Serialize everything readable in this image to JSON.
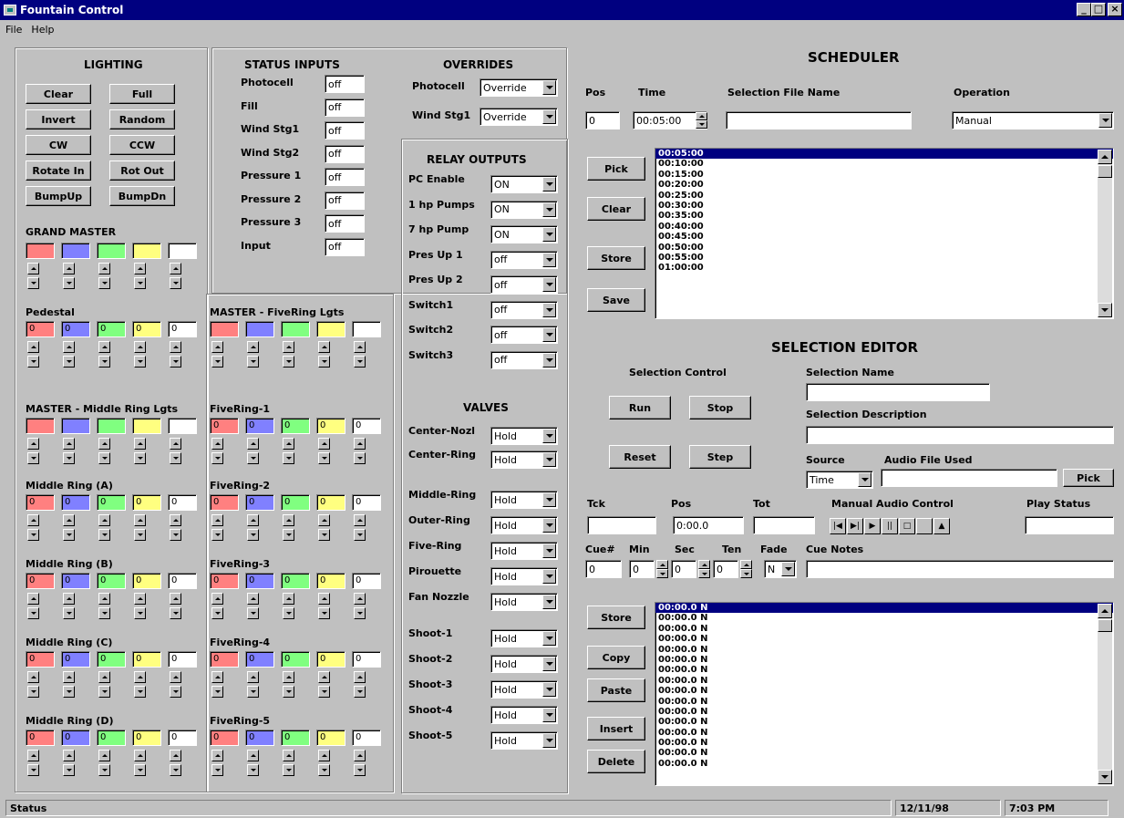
{
  "window": {
    "title": "Fountain Control"
  },
  "menu": [
    "File",
    "Help"
  ],
  "lighting": {
    "title": "LIGHTING",
    "buttons": [
      "Clear",
      "Full",
      "Invert",
      "Random",
      "CW",
      "CCW",
      "Rotate In",
      "Rot Out",
      "BumpUp",
      "BumpDn"
    ]
  },
  "grand_master": {
    "title": "GRAND MASTER"
  },
  "pedestal": {
    "title": "Pedestal",
    "values": [
      "0",
      "0",
      "0",
      "0",
      "0"
    ]
  },
  "master_middle": {
    "title": "MASTER - Middle Ring Lgts"
  },
  "master_five": {
    "title": "MASTER - FiveRing Lgts"
  },
  "light_groups_left": [
    {
      "title": "Middle Ring (A)",
      "values": [
        "0",
        "0",
        "0",
        "0",
        "0"
      ]
    },
    {
      "title": "Middle Ring (B)",
      "values": [
        "0",
        "0",
        "0",
        "0",
        "0"
      ]
    },
    {
      "title": "Middle Ring (C)",
      "values": [
        "0",
        "0",
        "0",
        "0",
        "0"
      ]
    },
    {
      "title": "Middle Ring (D)",
      "values": [
        "0",
        "0",
        "0",
        "0",
        "0"
      ]
    }
  ],
  "light_groups_right": [
    {
      "title": "FiveRing-1",
      "values": [
        "0",
        "0",
        "0",
        "0",
        "0"
      ]
    },
    {
      "title": "FiveRing-2",
      "values": [
        "0",
        "0",
        "0",
        "0",
        "0"
      ]
    },
    {
      "title": "FiveRing-3",
      "values": [
        "0",
        "0",
        "0",
        "0",
        "0"
      ]
    },
    {
      "title": "FiveRing-4",
      "values": [
        "0",
        "0",
        "0",
        "0",
        "0"
      ]
    },
    {
      "title": "FiveRing-5",
      "values": [
        "0",
        "0",
        "0",
        "0",
        "0"
      ]
    }
  ],
  "swatch_colors": [
    "#ff8080",
    "#8080ff",
    "#80ff80",
    "#ffff80",
    "#ffffff"
  ],
  "status_inputs": {
    "title": "STATUS INPUTS",
    "items": [
      {
        "label": "Photocell",
        "value": "off"
      },
      {
        "label": "Fill",
        "value": "off"
      },
      {
        "label": "Wind Stg1",
        "value": "off"
      },
      {
        "label": "Wind Stg2",
        "value": "off"
      },
      {
        "label": "Pressure 1",
        "value": "off"
      },
      {
        "label": "Pressure 2",
        "value": "off"
      },
      {
        "label": "Pressure 3",
        "value": "off"
      },
      {
        "label": "Input",
        "value": "off"
      }
    ]
  },
  "overrides": {
    "title": "OVERRIDES",
    "items": [
      {
        "label": "Photocell",
        "value": "Override"
      },
      {
        "label": "Wind Stg1",
        "value": "Override"
      }
    ]
  },
  "relay_outputs": {
    "title": "RELAY OUTPUTS",
    "items": [
      {
        "label": "PC Enable",
        "value": "ON"
      },
      {
        "label": "1 hp Pumps",
        "value": "ON"
      },
      {
        "label": "7 hp Pump",
        "value": "ON"
      },
      {
        "label": "Pres Up 1",
        "value": "off"
      },
      {
        "label": "Pres Up 2",
        "value": "off"
      },
      {
        "label": "Switch1",
        "value": "off"
      },
      {
        "label": "Switch2",
        "value": "off"
      },
      {
        "label": "Switch3",
        "value": "off"
      }
    ]
  },
  "valves": {
    "title": "VALVES",
    "items": [
      {
        "label": "Center-Nozl",
        "value": "Hold"
      },
      {
        "label": "Center-Ring",
        "value": "Hold"
      },
      {
        "label": "Middle-Ring",
        "value": "Hold"
      },
      {
        "label": "Outer-Ring",
        "value": "Hold"
      },
      {
        "label": "Five-Ring",
        "value": "Hold"
      },
      {
        "label": "Pirouette",
        "value": "Hold"
      },
      {
        "label": "Fan Nozzle",
        "value": "Hold"
      },
      {
        "label": "Shoot-1",
        "value": "Hold"
      },
      {
        "label": "Shoot-2",
        "value": "Hold"
      },
      {
        "label": "Shoot-3",
        "value": "Hold"
      },
      {
        "label": "Shoot-4",
        "value": "Hold"
      },
      {
        "label": "Shoot-5",
        "value": "Hold"
      }
    ]
  },
  "scheduler": {
    "title": "SCHEDULER",
    "pos_label": "Pos",
    "time_label": "Time",
    "file_label": "Selection File Name",
    "op_label": "Operation",
    "pos": "0",
    "time": "00:05:00",
    "file": "",
    "operation": "Manual",
    "buttons": [
      "Pick",
      "Clear",
      "Store",
      "Save"
    ],
    "times": [
      "00:05:00",
      "00:10:00",
      "00:15:00",
      "00:20:00",
      "00:25:00",
      "00:30:00",
      "00:35:00",
      "00:40:00",
      "00:45:00",
      "00:50:00",
      "00:55:00",
      "01:00:00"
    ]
  },
  "editor": {
    "title": "SELECTION EDITOR",
    "control_label": "Selection Control",
    "buttons": [
      "Run",
      "Stop",
      "Reset",
      "Step"
    ],
    "name_label": "Selection Name",
    "desc_label": "Selection Description",
    "source_label": "Source",
    "audio_label": "Audio File Used",
    "source": "Time",
    "pick": "Pick",
    "tck_label": "Tck",
    "pos_label": "Pos",
    "tot_label": "Tot",
    "manual_audio_label": "Manual Audio Control",
    "play_status_label": "Play Status",
    "pos_value": "0:00.0",
    "cue_labels": [
      "Cue#",
      "Min",
      "Sec",
      "Ten",
      "Fade",
      "Cue Notes"
    ],
    "cue_values": [
      "0",
      "0",
      "0",
      "0",
      "N"
    ],
    "cue_buttons": [
      "Store",
      "Copy",
      "Paste",
      "Insert",
      "Delete"
    ],
    "cues": [
      "00:00.0  N",
      "00:00.0  N",
      "00:00.0  N",
      "00:00.0  N",
      "00:00.0  N",
      "00:00.0  N",
      "00:00.0  N",
      "00:00.0  N",
      "00:00.0  N",
      "00:00.0  N",
      "00:00.0  N",
      "00:00.0  N",
      "00:00.0  N",
      "00:00.0  N",
      "00:00.0  N",
      "00:00.0  N"
    ]
  },
  "status_bar": {
    "status": "Status",
    "date": "12/11/98",
    "time": "7:03 PM"
  }
}
